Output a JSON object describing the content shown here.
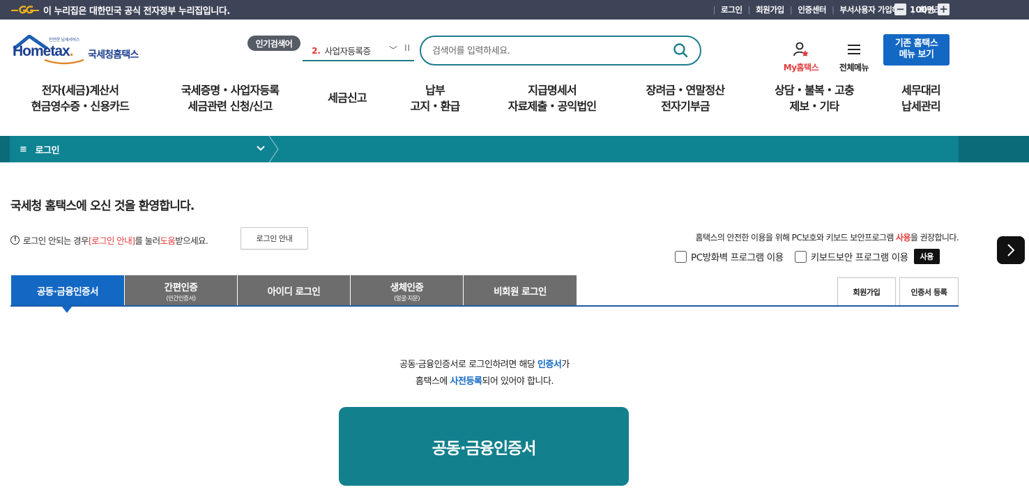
{
  "gov_bar": {
    "notice": "이 누리집은 대한민국 공식 전자정부 누리집입니다.",
    "links": [
      "로그인",
      "회원가입",
      "인증센터",
      "부서사용자 가입하기",
      "화면크기"
    ],
    "zoom_minus": "−",
    "zoom_value": "100%",
    "zoom_plus": "+"
  },
  "header": {
    "logo_small": "안전한 납세서비스",
    "logo_main_a": "Hom",
    "logo_main_b": "e",
    "logo_main_c": "tax",
    "logo_main_d": ".",
    "logo_kr": "국세청홈택스",
    "popular_badge": "인기검색어",
    "popular_rank": "2.",
    "popular_term": "사업자등록증",
    "search_placeholder": "검색어를 입력하세요.",
    "my_hometax": "My홈택스",
    "all_menu": "전체메뉴",
    "old_site_line1": "기존 홈택스",
    "old_site_line2": "메뉴 보기"
  },
  "gnb": [
    {
      "l1": "전자(세금)계산서",
      "l2": "현금영수증・신용카드"
    },
    {
      "l1": "국세증명・사업자등록",
      "l2": "세금관련 신청/신고"
    },
    {
      "l1": "세금신고",
      "l2": ""
    },
    {
      "l1": "납부",
      "l2": "고지・환급"
    },
    {
      "l1": "지급명세서",
      "l2": "자료제출・공익법인"
    },
    {
      "l1": "장려금・연말정산",
      "l2": "전자기부금"
    },
    {
      "l1": "상담・불복・고충",
      "l2": "제보・기타"
    },
    {
      "l1": "세무대리",
      "l2": "납세관리"
    }
  ],
  "breadcrumb": {
    "menu_icon": "≡",
    "label": "로그인"
  },
  "content": {
    "welcome": "국세청 홈택스에 오신 것을 환영합니다.",
    "help_a": "로그인 안되는 경우 ",
    "help_b": "[로그인 안내]",
    "help_c": "를 눌러 ",
    "help_d": "도움",
    "help_e": "받으세요.",
    "guide_button": "로그인 안내",
    "security_a": "홈택스의 안전한 이용을 위해 PC보호와 키보드 보안프로그램 ",
    "security_b": "사용",
    "security_c": "을 권장합니다.",
    "pc_firewall": "PC방화벽 프로그램 이용",
    "keyboard_security": "키보드보안 프로그램 이용",
    "use_button": "사용"
  },
  "tabs": [
    {
      "label": "공동·금융인증서",
      "sub": ""
    },
    {
      "label": "간편인증",
      "sub": "(민간인증서)"
    },
    {
      "label": "아이디 로그인",
      "sub": ""
    },
    {
      "label": "생체인증",
      "sub": "(얼굴·지문)"
    },
    {
      "label": "비회원 로그인",
      "sub": ""
    }
  ],
  "side_buttons": {
    "signup": "회원가입",
    "cert_register": "인증서 등록"
  },
  "cert_panel": {
    "line1_a": "공동·금융인증서로 로그인하려면 해당 ",
    "line1_b": "인증서",
    "line1_c": "가",
    "line2_a": "홈택스에 ",
    "line2_b": "사전등록",
    "line2_c": "되어 있어야 합니다.",
    "button": "공동·금융인증서"
  },
  "colors": {
    "gov_bar": "#3d4457",
    "teal": "#0e8392",
    "blue": "#1368c4",
    "red": "#e23c3c"
  },
  "icons": [
    "eg-logo-icon",
    "search-icon",
    "my-hometax-icon",
    "hamburger-icon",
    "chevron-down-icon",
    "next-arrow-icon",
    "warning-icon"
  ]
}
